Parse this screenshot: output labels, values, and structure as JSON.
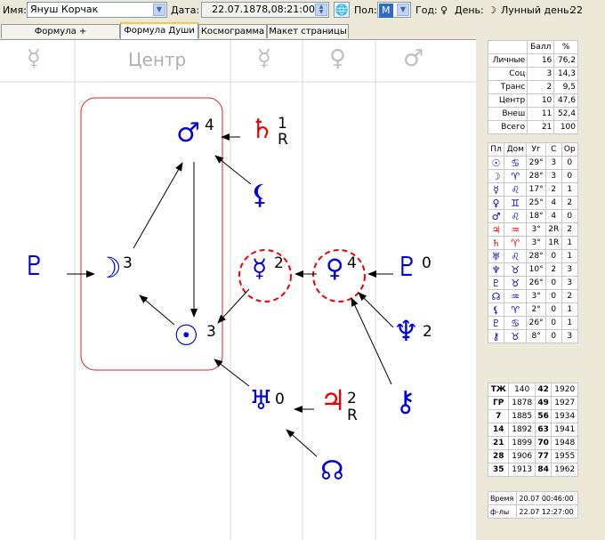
{
  "toolbar": {
    "name_label": "Имя:",
    "name_value": "Януш Корчак",
    "date_label": "Дата:",
    "date_value": "22.07.1878,08:21:00",
    "sex_label": "Пол:",
    "sex_value": "М",
    "year_label": "Год:",
    "year_glyph": "♀",
    "day_label": "День:",
    "day_glyph": "☽",
    "lunar_label": "Лунный день:",
    "lunar_value": "22"
  },
  "tabs": [
    "Формула + Космограмма",
    "Формула Души",
    "Космограмма",
    "Макет страницы"
  ],
  "columns": {
    "headers": [
      "☿",
      "Центр",
      "☿",
      "♀",
      "♂"
    ]
  },
  "diagram": {
    "nodes": [
      {
        "id": "mars",
        "glyph": "♂",
        "count": "4",
        "color": "#0000dd"
      },
      {
        "id": "saturn",
        "glyph": "♄",
        "count": "1",
        "retro": "R",
        "color": "#ee0000"
      },
      {
        "id": "lilith",
        "glyph": "⚸",
        "color": "#0000dd"
      },
      {
        "id": "moon",
        "glyph": "☽",
        "count": "3",
        "color": "#0000dd"
      },
      {
        "id": "sun",
        "glyph": "☉",
        "count": "3",
        "color": "#0000dd"
      },
      {
        "id": "mercury",
        "glyph": "☿",
        "count": "2",
        "color": "#0000dd"
      },
      {
        "id": "venus",
        "glyph": "♀",
        "count": "4",
        "color": "#0000dd"
      },
      {
        "id": "pluto_r",
        "glyph": "♇",
        "count": "0",
        "color": "#0000dd"
      },
      {
        "id": "pluto_l",
        "glyph": "♇",
        "color": "#0000dd"
      },
      {
        "id": "neptune",
        "glyph": "♆",
        "count": "2",
        "color": "#0000dd"
      },
      {
        "id": "uranus",
        "glyph": "♅",
        "count": "0",
        "color": "#0000dd"
      },
      {
        "id": "jupiter",
        "glyph": "♃",
        "count": "2",
        "retro": "R",
        "color": "#ee0000"
      },
      {
        "id": "chiron",
        "glyph": "⚷",
        "color": "#0000dd"
      },
      {
        "id": "node",
        "glyph": "☊",
        "color": "#0000dd"
      }
    ]
  },
  "score_table": {
    "headers": [
      "",
      "Балл",
      "%"
    ],
    "rows": [
      [
        "Личные",
        "16",
        "76,2"
      ],
      [
        "Соц",
        "3",
        "14,3"
      ],
      [
        "Транс",
        "2",
        "9,5"
      ],
      [
        "Центр",
        "10",
        "47,6"
      ],
      [
        "Внеш",
        "11",
        "52,4"
      ],
      [
        "Всего",
        "21",
        "100"
      ]
    ]
  },
  "planet_table": {
    "headers": [
      "Пл",
      "Дом",
      "Уг",
      "С",
      "Ор"
    ],
    "rows": [
      {
        "pl": "☉",
        "dom": "♋",
        "ug": "29°",
        "c": "3",
        "or": "0",
        "color": "#0000dd"
      },
      {
        "pl": "☽",
        "dom": "♈",
        "ug": "28°",
        "c": "3",
        "or": "0",
        "color": "#0000dd"
      },
      {
        "pl": "☿",
        "dom": "♌",
        "ug": "17°",
        "c": "2",
        "or": "1",
        "color": "#0000dd"
      },
      {
        "pl": "♀",
        "dom": "♊",
        "ug": "25°",
        "c": "4",
        "or": "2",
        "color": "#0000dd"
      },
      {
        "pl": "♂",
        "dom": "♌",
        "ug": "18°",
        "c": "4",
        "or": "0",
        "color": "#0000dd"
      },
      {
        "pl": "♃",
        "dom": "♒",
        "ug": "3°",
        "c": "2R",
        "or": "2",
        "color": "#ee0000"
      },
      {
        "pl": "♄",
        "dom": "♈",
        "ug": "3°",
        "c": "1R",
        "or": "1",
        "color": "#ee0000"
      },
      {
        "pl": "♅",
        "dom": "♌",
        "ug": "28°",
        "c": "0",
        "or": "1",
        "color": "#0000dd"
      },
      {
        "pl": "♆",
        "dom": "♉",
        "ug": "10°",
        "c": "2",
        "or": "3",
        "color": "#0000dd"
      },
      {
        "pl": "♇",
        "dom": "♉",
        "ug": "26°",
        "c": "0",
        "or": "3",
        "color": "#0000dd"
      },
      {
        "pl": "☊",
        "dom": "♒",
        "ug": "3°",
        "c": "0",
        "or": "2",
        "color": "#0000dd"
      },
      {
        "pl": "⚸",
        "dom": "♈",
        "ug": "2°",
        "c": "0",
        "or": "1",
        "color": "#0000dd"
      },
      {
        "pl": "♇",
        "dom": "♋",
        "ug": "26°",
        "c": "0",
        "or": "1",
        "color": "#0000dd"
      },
      {
        "pl": "⚷",
        "dom": "♉",
        "ug": "8°",
        "c": "0",
        "or": "3",
        "color": "#0000dd"
      }
    ]
  },
  "age_table": {
    "rows": [
      [
        "ТЖ",
        "140",
        "42",
        "1920"
      ],
      [
        "ГР",
        "1878",
        "49",
        "1927"
      ],
      [
        "7",
        "1885",
        "56",
        "1934"
      ],
      [
        "14",
        "1892",
        "63",
        "1941"
      ],
      [
        "21",
        "1899",
        "70",
        "1948"
      ],
      [
        "28",
        "1906",
        "77",
        "1955"
      ],
      [
        "35",
        "1913",
        "84",
        "1962"
      ]
    ]
  },
  "time_table": {
    "rows": [
      [
        "Время",
        "20.07 00:46:00"
      ],
      [
        "ф-лы",
        "22.07 12:27:00"
      ]
    ]
  }
}
